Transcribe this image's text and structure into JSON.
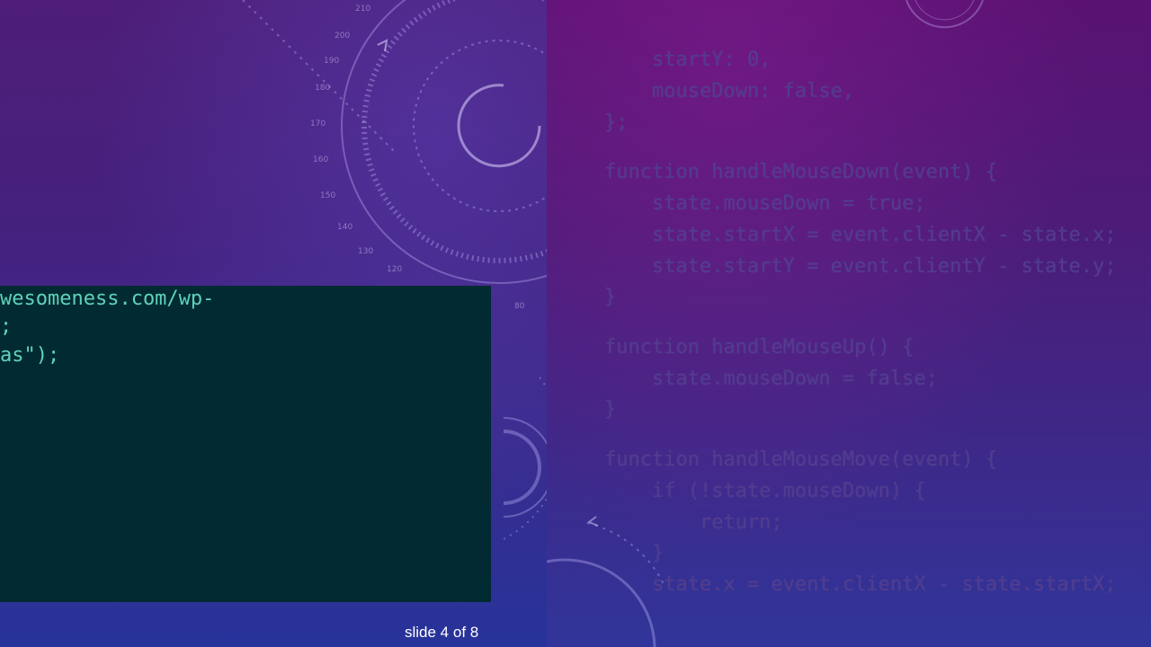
{
  "left_slide": {
    "code_lines": [
      "wesomeness.com/wp-",
      ";",
      "as\");"
    ],
    "slide_counter": "slide 4 of 8"
  },
  "right_slide": {
    "code_lines": [
      "    startY: 0,",
      "    mouseDown: false,",
      "};",
      "function handleMouseDown(event) {",
      "    state.mouseDown = true;",
      "    state.startX = event.clientX - state.x;",
      "    state.startY = event.clientY - state.y;",
      "}",
      "function handleMouseUp() {",
      "    state.mouseDown = false;",
      "}",
      "function handleMouseMove(event) {",
      "    if (!state.mouseDown) {",
      "        return;",
      "    }",
      "    state.x = event.clientX - state.startX;"
    ]
  },
  "colors": {
    "code_bg": "#022a33",
    "code_text": "#5fd3b8"
  },
  "dial_ticks": [
    "210",
    "200",
    "190",
    "180",
    "170",
    "160",
    "150",
    "140",
    "130",
    "120",
    "80"
  ]
}
